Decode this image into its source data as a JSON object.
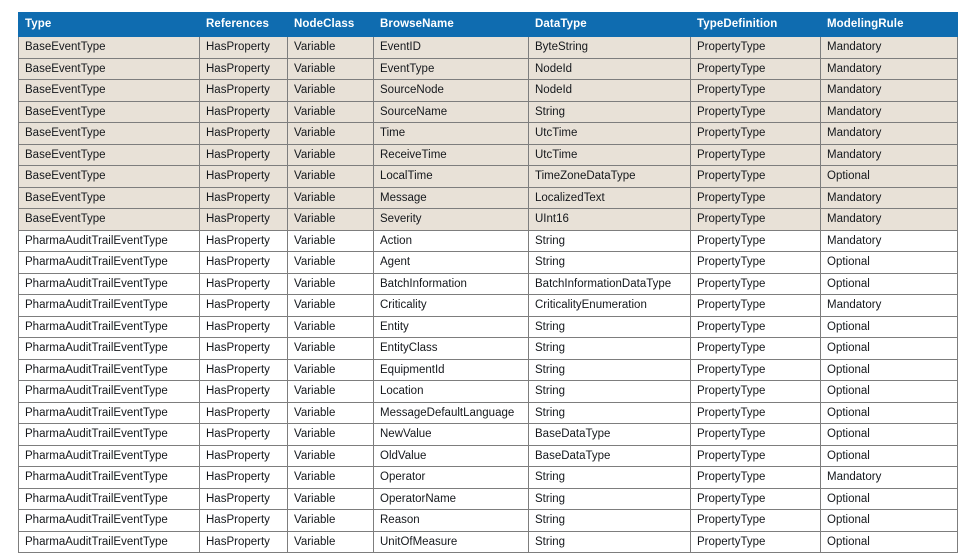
{
  "table": {
    "caption": "",
    "accent_color": "#0f6cb0",
    "shaded_row_color": "#e8e1d7",
    "plain_row_color": "#ffffff",
    "border_color": "#7d7d7d",
    "columns": [
      "Type",
      "References",
      "NodeClass",
      "BrowseName",
      "DataType",
      "TypeDefinition",
      "ModelingRule"
    ],
    "rows": [
      {
        "shaded": true,
        "cells": [
          "BaseEventType",
          "HasProperty",
          "Variable",
          "EventID",
          "ByteString",
          "PropertyType",
          "Mandatory"
        ]
      },
      {
        "shaded": true,
        "cells": [
          "BaseEventType",
          "HasProperty",
          "Variable",
          "EventType",
          "NodeId",
          "PropertyType",
          "Mandatory"
        ]
      },
      {
        "shaded": true,
        "cells": [
          "BaseEventType",
          "HasProperty",
          "Variable",
          "SourceNode",
          "NodeId",
          "PropertyType",
          "Mandatory"
        ]
      },
      {
        "shaded": true,
        "cells": [
          "BaseEventType",
          "HasProperty",
          "Variable",
          "SourceName",
          "String",
          "PropertyType",
          "Mandatory"
        ]
      },
      {
        "shaded": true,
        "cells": [
          "BaseEventType",
          "HasProperty",
          "Variable",
          "Time",
          "UtcTime",
          "PropertyType",
          "Mandatory"
        ]
      },
      {
        "shaded": true,
        "cells": [
          "BaseEventType",
          "HasProperty",
          "Variable",
          "ReceiveTime",
          "UtcTime",
          "PropertyType",
          "Mandatory"
        ]
      },
      {
        "shaded": true,
        "cells": [
          "BaseEventType",
          "HasProperty",
          "Variable",
          "LocalTime",
          "TimeZoneDataType",
          "PropertyType",
          "Optional"
        ]
      },
      {
        "shaded": true,
        "cells": [
          "BaseEventType",
          "HasProperty",
          "Variable",
          "Message",
          "LocalizedText",
          "PropertyType",
          "Mandatory"
        ]
      },
      {
        "shaded": true,
        "cells": [
          "BaseEventType",
          "HasProperty",
          "Variable",
          "Severity",
          "UInt16",
          "PropertyType",
          "Mandatory"
        ]
      },
      {
        "shaded": false,
        "cells": [
          "PharmaAuditTrailEventType",
          "HasProperty",
          "Variable",
          "Action",
          "String",
          "PropertyType",
          "Mandatory"
        ]
      },
      {
        "shaded": false,
        "cells": [
          "PharmaAuditTrailEventType",
          "HasProperty",
          "Variable",
          "Agent",
          "String",
          "PropertyType",
          "Optional"
        ]
      },
      {
        "shaded": false,
        "cells": [
          "PharmaAuditTrailEventType",
          "HasProperty",
          "Variable",
          "BatchInformation",
          "BatchInformationDataType",
          "PropertyType",
          "Optional"
        ]
      },
      {
        "shaded": false,
        "cells": [
          "PharmaAuditTrailEventType",
          "HasProperty",
          "Variable",
          "Criticality",
          "CriticalityEnumeration",
          "PropertyType",
          "Mandatory"
        ]
      },
      {
        "shaded": false,
        "cells": [
          "PharmaAuditTrailEventType",
          "HasProperty",
          "Variable",
          "Entity",
          "String",
          "PropertyType",
          "Optional"
        ]
      },
      {
        "shaded": false,
        "cells": [
          "PharmaAuditTrailEventType",
          "HasProperty",
          "Variable",
          "EntityClass",
          "String",
          "PropertyType",
          "Optional"
        ]
      },
      {
        "shaded": false,
        "cells": [
          "PharmaAuditTrailEventType",
          "HasProperty",
          "Variable",
          "EquipmentId",
          "String",
          "PropertyType",
          "Optional"
        ]
      },
      {
        "shaded": false,
        "cells": [
          "PharmaAuditTrailEventType",
          "HasProperty",
          "Variable",
          "Location",
          "String",
          "PropertyType",
          "Optional"
        ]
      },
      {
        "shaded": false,
        "cells": [
          "PharmaAuditTrailEventType",
          "HasProperty",
          "Variable",
          "MessageDefaultLanguage",
          "String",
          "PropertyType",
          "Optional"
        ]
      },
      {
        "shaded": false,
        "cells": [
          "PharmaAuditTrailEventType",
          "HasProperty",
          "Variable",
          "NewValue",
          "BaseDataType",
          "PropertyType",
          "Optional"
        ]
      },
      {
        "shaded": false,
        "cells": [
          "PharmaAuditTrailEventType",
          "HasProperty",
          "Variable",
          "OldValue",
          "BaseDataType",
          "PropertyType",
          "Optional"
        ]
      },
      {
        "shaded": false,
        "cells": [
          "PharmaAuditTrailEventType",
          "HasProperty",
          "Variable",
          "Operator",
          "String",
          "PropertyType",
          "Mandatory"
        ]
      },
      {
        "shaded": false,
        "cells": [
          "PharmaAuditTrailEventType",
          "HasProperty",
          "Variable",
          "OperatorName",
          "String",
          "PropertyType",
          "Optional"
        ]
      },
      {
        "shaded": false,
        "cells": [
          "PharmaAuditTrailEventType",
          "HasProperty",
          "Variable",
          "Reason",
          "String",
          "PropertyType",
          "Optional"
        ]
      },
      {
        "shaded": false,
        "cells": [
          "PharmaAuditTrailEventType",
          "HasProperty",
          "Variable",
          "UnitOfMeasure",
          "String",
          "PropertyType",
          "Optional"
        ]
      }
    ]
  }
}
